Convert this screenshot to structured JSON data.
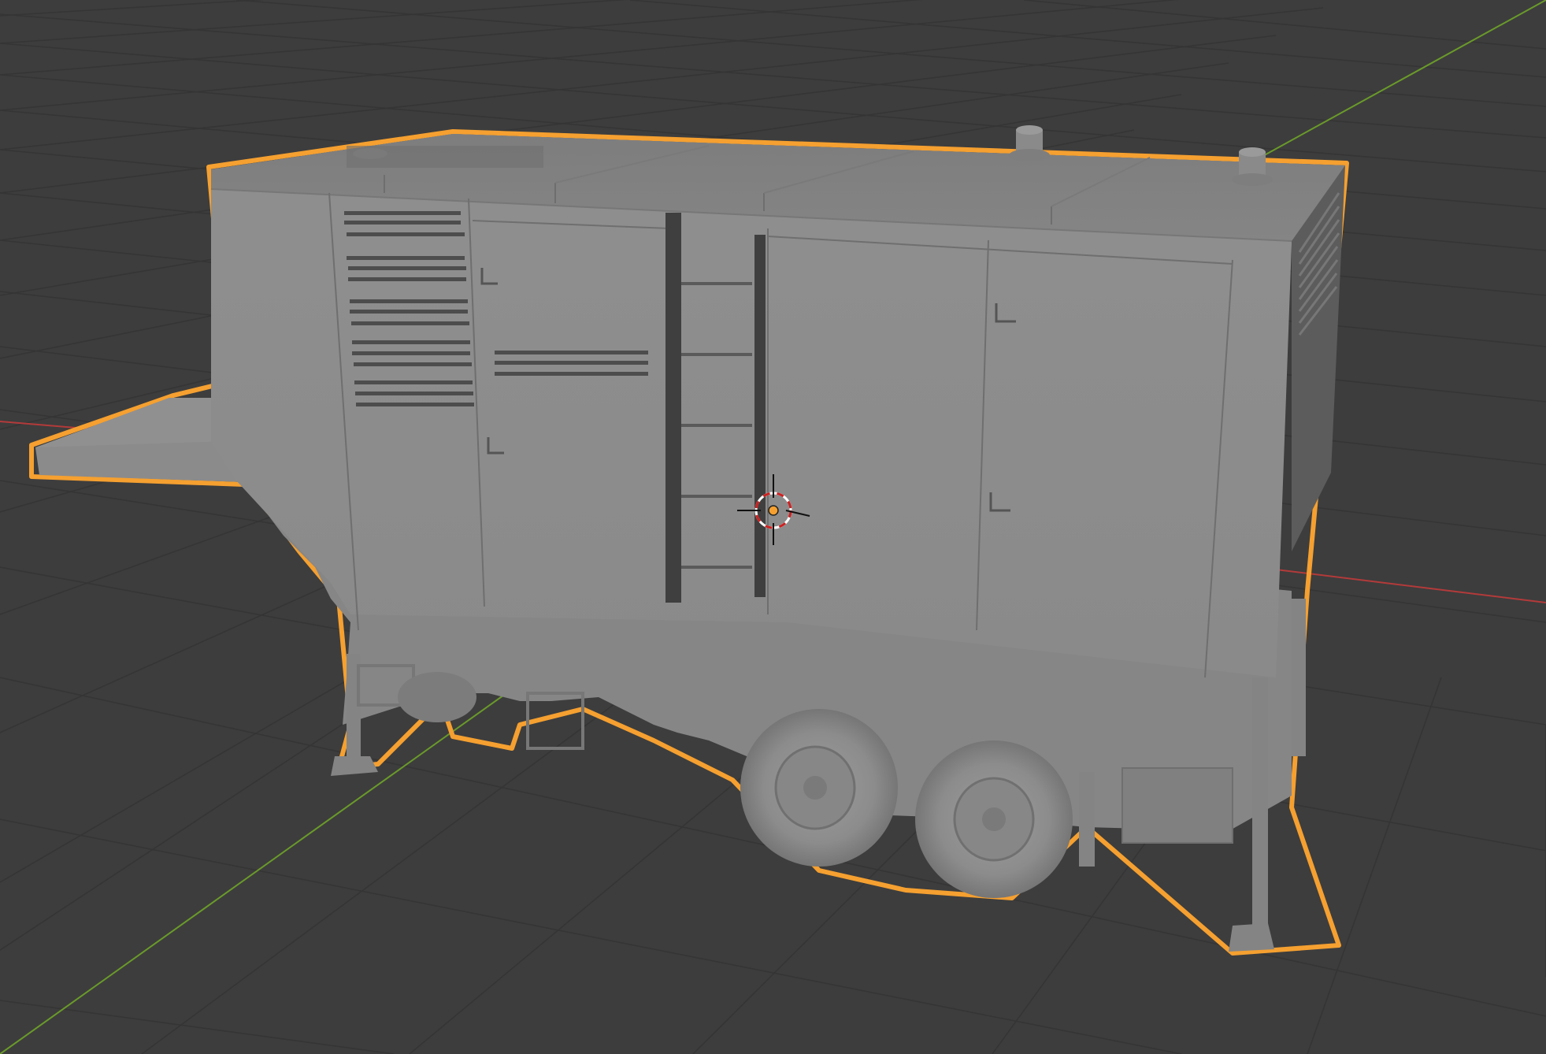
{
  "viewport": {
    "background": "#3d3d3d",
    "grid_color": "#333333",
    "x_axis_color": "#b33a3a",
    "y_axis_color": "#6a9a2a",
    "selection_outline_color": "#f5a030",
    "mesh_color": "#8c8c8c"
  },
  "scene": {
    "selected_object": "trailer-generator",
    "wheel_count": 2,
    "ladder_rungs": 5,
    "cursor_icon": "3d-cursor-icon",
    "origin_icon": "object-origin-icon"
  }
}
